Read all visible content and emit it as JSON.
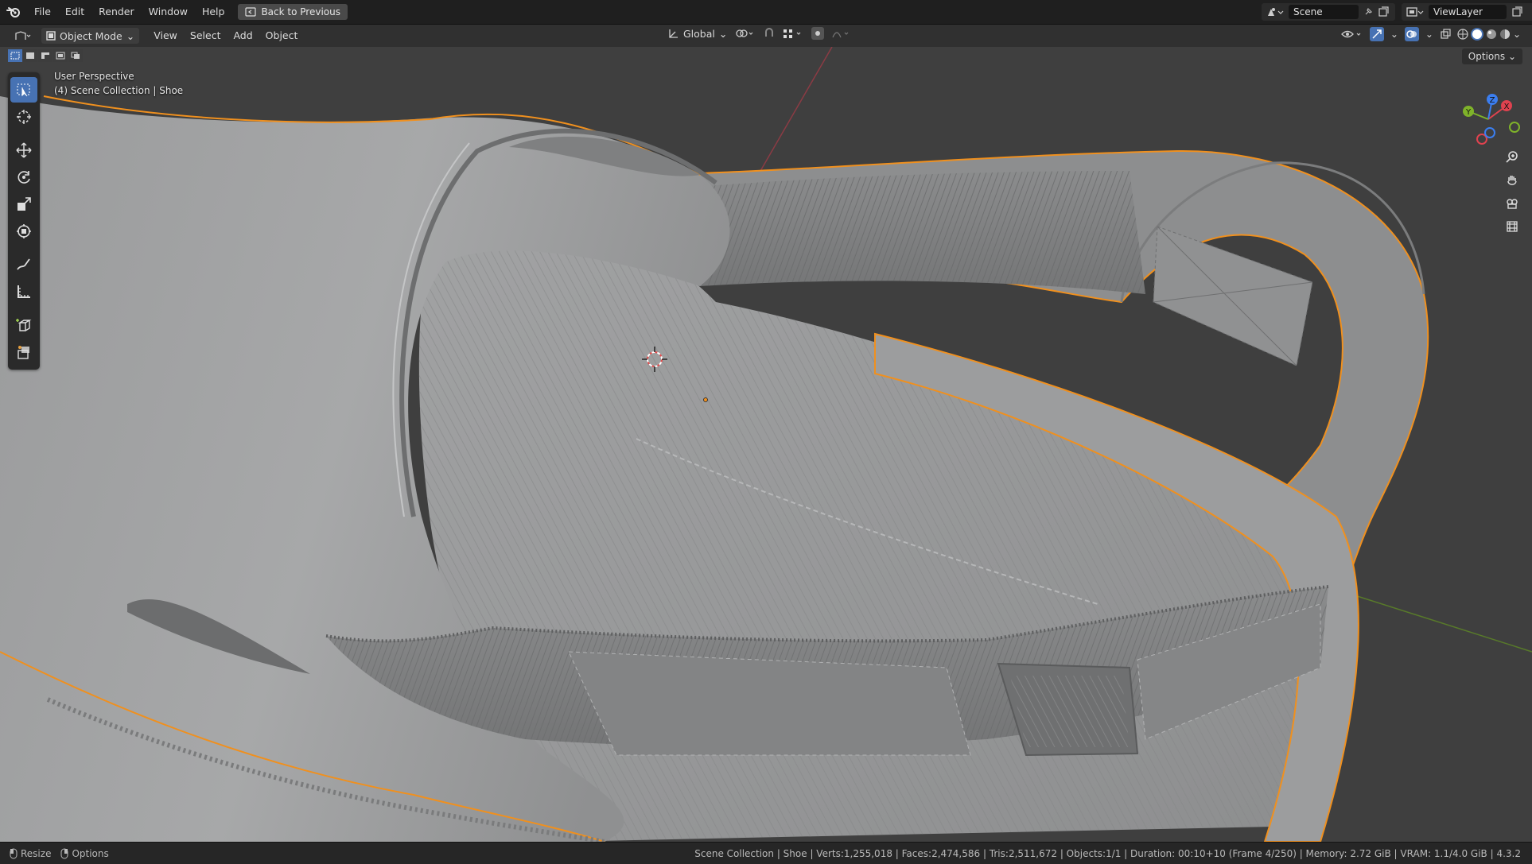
{
  "topbar": {
    "menus": [
      "File",
      "Edit",
      "Render",
      "Window",
      "Help"
    ],
    "back_label": "Back to Previous",
    "scene_name": "Scene",
    "view_layer": "ViewLayer"
  },
  "header": {
    "mode": "Object Mode",
    "menus": [
      "View",
      "Select",
      "Add",
      "Object"
    ],
    "orientation": "Global"
  },
  "viewport": {
    "perspective": "User Perspective",
    "collection_path": "(4) Scene Collection | Shoe",
    "options_label": "Options",
    "gizmo_axes": {
      "x": "X",
      "y": "Y",
      "z": "Z"
    }
  },
  "statusbar": {
    "left_items": [
      "Resize",
      "Options"
    ],
    "stats": "Scene Collection | Shoe | Verts:1,255,018 | Faces:2,474,586 | Tris:2,511,672 | Objects:1/1 | Duration: 00:10+10 (Frame 4/250) | Memory: 2.72 GiB | VRAM: 1.1/4.0 GiB | 4.3.2"
  },
  "colors": {
    "accent": "#4772b3",
    "selection_outline": "#f0901e",
    "axis_x": "#e0424f",
    "axis_y": "#7fb32a",
    "axis_z": "#3b7ef0"
  },
  "icons": [
    "blender-logo-icon",
    "back-icon",
    "scene-icon",
    "pin-icon",
    "new-scene-icon",
    "view-layer-icon",
    "editor-type-icon",
    "object-mode-icon",
    "transform-orientation-icon",
    "pivot-icon",
    "snap-icon",
    "proportional-icon",
    "visibility-icon",
    "gizmo-icon",
    "overlay-icon",
    "xray-icon",
    "shading-icons",
    "select-box-icon",
    "cursor-icon",
    "move-icon",
    "rotate-icon",
    "scale-icon",
    "transform-icon",
    "annotate-icon",
    "measure-icon",
    "add-cube-icon",
    "extrude-icon",
    "zoom-icon",
    "pan-hand-icon",
    "camera-icon",
    "ortho-grid-icon"
  ]
}
